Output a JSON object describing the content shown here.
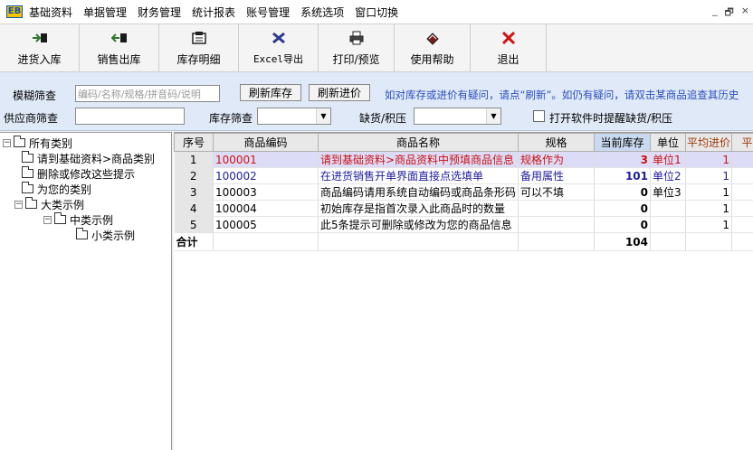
{
  "app": {
    "logo_text": "EB"
  },
  "menu": [
    {
      "label": "基础资料"
    },
    {
      "label": "单据管理"
    },
    {
      "label": "财务管理"
    },
    {
      "label": "统计报表"
    },
    {
      "label": "账号管理"
    },
    {
      "label": "系统选项"
    },
    {
      "label": "窗口切换"
    }
  ],
  "window_controls": {
    "minimize": "_",
    "restore": "🗗",
    "close": "×"
  },
  "toolbar": [
    {
      "label": "进货入库",
      "icon": "stock-in-icon"
    },
    {
      "label": "销售出库",
      "icon": "stock-out-icon"
    },
    {
      "label": "库存明细",
      "icon": "inventory-detail-icon"
    },
    {
      "label": "Excel导出",
      "icon": "excel-export-icon"
    },
    {
      "label": "打印/预览",
      "icon": "printer-icon"
    },
    {
      "label": "使用帮助",
      "icon": "help-book-icon"
    },
    {
      "label": "退出",
      "icon": "exit-x-icon"
    }
  ],
  "filters": {
    "fuzzy_label": "模糊筛查",
    "fuzzy_placeholder": "编码/名称/规格/拼音码/说明",
    "refresh_stock": "刷新库存",
    "refresh_price": "刷新进价",
    "hint": "如对库存或进价有疑问，请点“刷新”。如仍有疑问，请双击某商品追查其历史",
    "supplier_label": "供应商筛查",
    "stock_label": "库存筛查",
    "shortage_label": "缺货/积压",
    "remind_label": "打开软件时提醒缺货/积压",
    "remind_checked": false
  },
  "tree": {
    "root": "所有类别",
    "items": [
      "请到基础资料>商品类别",
      "删除或修改这些提示",
      "为您的类别"
    ],
    "big": "大类示例",
    "mid": "中类示例",
    "small": "小类示例"
  },
  "grid": {
    "headers": [
      "序号",
      "商品编码",
      "商品名称",
      "规格",
      "当前库存",
      "单位",
      "平均进价",
      "平"
    ],
    "rows": [
      {
        "seq": "1",
        "code": "100001",
        "name": "请到基础资料>商品资料中预填商品信息",
        "spec": "规格作为",
        "stock": "3",
        "unit": "单位1",
        "price": "1"
      },
      {
        "seq": "2",
        "code": "100002",
        "name": "在进货销售开单界面直接点选填单",
        "spec": "备用属性",
        "stock": "101",
        "unit": "单位2",
        "price": "1"
      },
      {
        "seq": "3",
        "code": "100003",
        "name": "商品编码请用系统自动编码或商品条形码",
        "spec": "可以不填",
        "stock": "0",
        "unit": "单位3",
        "price": "1"
      },
      {
        "seq": "4",
        "code": "100004",
        "name": "初始库存是指首次录入此商品时的数量",
        "spec": "",
        "stock": "0",
        "unit": "",
        "price": "1"
      },
      {
        "seq": "5",
        "code": "100005",
        "name": "此5条提示可删除或修改为您的商品信息",
        "spec": "",
        "stock": "0",
        "unit": "",
        "price": "1"
      }
    ],
    "total_label": "合计",
    "total_stock": "104"
  }
}
